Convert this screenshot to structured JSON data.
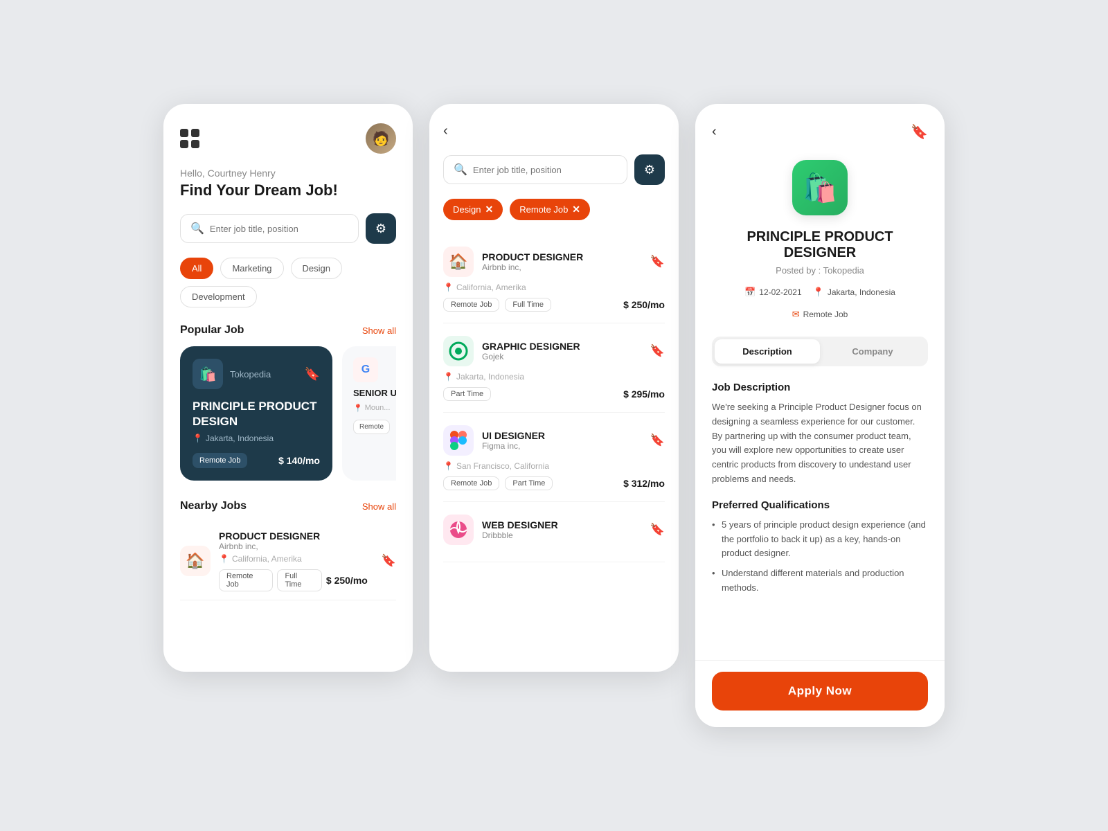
{
  "screen1": {
    "greeting": "Hello, Courtney Henry",
    "headline": "Find Your Dream Job!",
    "search_placeholder": "Enter job title, position",
    "categories": [
      {
        "label": "All",
        "active": true
      },
      {
        "label": "Marketing",
        "active": false
      },
      {
        "label": "Design",
        "active": false
      },
      {
        "label": "Development",
        "active": false
      }
    ],
    "popular_section": "Popular Job",
    "show_all": "Show all",
    "featured_job": {
      "company": "Tokopedia",
      "title": "PRINCIPLE PRODUCT DESIGN",
      "location": "Jakarta, Indonesia",
      "badge": "Remote Job",
      "salary": "$ 140/mo"
    },
    "mini_job": {
      "company": "Google",
      "title": "SENIOR UI/UX DE",
      "location": "Moun...",
      "badge": "Remote"
    },
    "nearby_section": "Nearby Jobs",
    "nearby_show_all": "Show all",
    "nearby_jobs": [
      {
        "title": "PRODUCT DESIGNER",
        "company": "Airbnb inc,",
        "location": "California, Amerika",
        "tags": [
          "Remote Job",
          "Full Time"
        ],
        "salary": "$ 250/mo"
      }
    ]
  },
  "screen2": {
    "search_placeholder": "Enter job title, position",
    "filters": [
      "Design",
      "Remote Job"
    ],
    "jobs": [
      {
        "title": "PRODUCT DESIGNER",
        "company": "Airbnb inc,",
        "location": "California, Amerika",
        "tags": [
          "Remote Job",
          "Full Time"
        ],
        "salary": "$ 250/mo",
        "logo_type": "airbnb"
      },
      {
        "title": "GRAPHIC DESIGNER",
        "company": "Gojek",
        "location": "Jakarta, Indonesia",
        "tags": [
          "Part Time"
        ],
        "salary": "$ 295/mo",
        "logo_type": "gojek"
      },
      {
        "title": "UI DESIGNER",
        "company": "Figma inc,",
        "location": "San Francisco, California",
        "tags": [
          "Remote Job",
          "Part Time"
        ],
        "salary": "$ 312/mo",
        "logo_type": "figma"
      },
      {
        "title": "WEB DESIGNER",
        "company": "Dribbble",
        "location": "",
        "tags": [],
        "salary": "",
        "logo_type": "dribbble"
      }
    ]
  },
  "screen3": {
    "company": "Tokopedia",
    "job_title": "PRINCIPLE PRODUCT DESIGNER",
    "posted_by": "Posted by : Tokopedia",
    "date": "12-02-2021",
    "location": "Jakarta, Indonesia",
    "work_type": "Remote Job",
    "tabs": [
      "Description",
      "Company"
    ],
    "active_tab": "Description",
    "desc_title": "Job Description",
    "desc_text": "We're seeking a Principle Product Designer focus on designing a seamless experience for our customer. By partnering up with the consumer product team, you will explore new opportunities to create user centric products from discovery to undestand user problems and needs.",
    "pref_title": "Preferred Qualifications",
    "pref_items": [
      "5 years of  principle product design experience (and the portfolio to back it up) as a key, hands-on product designer.",
      "Understand different materials and production methods."
    ],
    "apply_button": "Apply Now"
  },
  "icons": {
    "back": "‹",
    "bookmark_outline": "🔖",
    "search": "⌕",
    "location_pin": "📍",
    "calendar": "📅",
    "filter": "≡",
    "grid": "⊞"
  }
}
